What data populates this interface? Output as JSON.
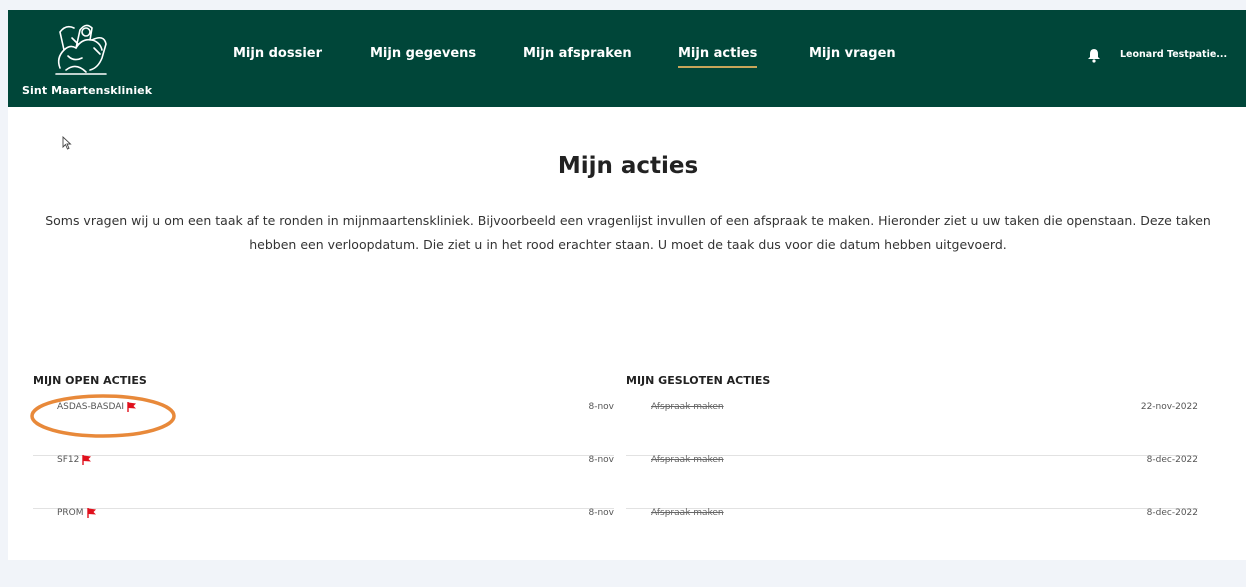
{
  "brand": {
    "name": "Sint Maartenskliniek"
  },
  "nav": {
    "items": [
      {
        "label": "Mijn dossier"
      },
      {
        "label": "Mijn gegevens"
      },
      {
        "label": "Mijn afspraken"
      },
      {
        "label": "Mijn acties"
      },
      {
        "label": "Mijn vragen"
      }
    ],
    "active": "Mijn acties"
  },
  "user": {
    "name": "Leonard Testpatie..."
  },
  "page": {
    "title": "Mijn acties",
    "intro_line1": "Soms vragen wij u om een taak af te ronden in mijnmaartenskliniek. Bijvoorbeeld een vragenlijst invullen of een afspraak te maken. Hieronder ziet u uw taken die openstaan. Deze taken",
    "intro_line2": "hebben een verloopdatum. Die ziet u in het rood erachter staan. U moet de taak dus voor die datum hebben uitgevoerd."
  },
  "open_actions": {
    "title": "MIJN OPEN ACTIES",
    "items": [
      {
        "name": "ASDAS-BASDAI",
        "date": "8-nov"
      },
      {
        "name": "SF12",
        "date": "8-nov"
      },
      {
        "name": "PROM",
        "date": "8-nov"
      }
    ]
  },
  "closed_actions": {
    "title": "MIJN GESLOTEN ACTIES",
    "items": [
      {
        "name": "Afspraak maken",
        "date": "22-nov-2022"
      },
      {
        "name": "Afspraak maken",
        "date": "8-dec-2022"
      },
      {
        "name": "Afspraak maken",
        "date": "8-dec-2022"
      }
    ]
  },
  "colors": {
    "header_bg": "#004639",
    "active_underline": "#c8a55a",
    "flag": "#e0101c",
    "highlight_ring": "#e8893a"
  },
  "icons": [
    "logo-emblem",
    "bell-icon",
    "flag-icon",
    "cursor-icon"
  ]
}
